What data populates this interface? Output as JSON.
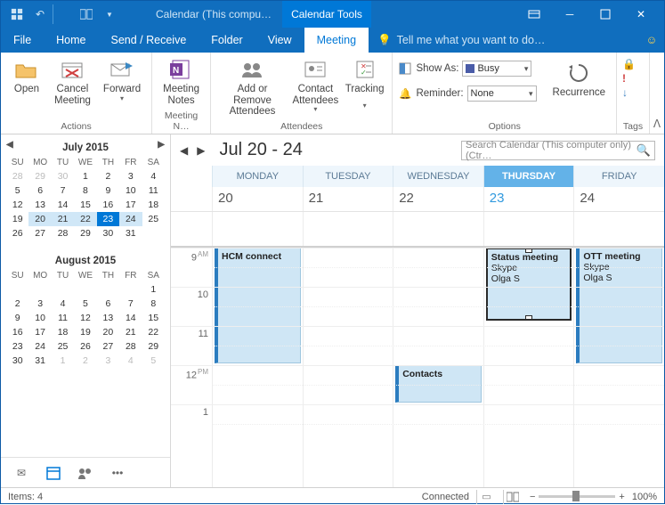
{
  "titlebar": {
    "title": "Calendar (This compu…",
    "tool_tab": "Calendar Tools"
  },
  "menubar": {
    "file": "File",
    "home": "Home",
    "sendreceive": "Send / Receive",
    "folder": "Folder",
    "view": "View",
    "meeting": "Meeting",
    "tell_placeholder": "Tell me what you want to do…"
  },
  "ribbon": {
    "actions": {
      "label": "Actions",
      "open": "Open",
      "cancel": "Cancel\nMeeting",
      "forward": "Forward"
    },
    "notes": {
      "label": "Meeting N…",
      "notes": "Meeting\nNotes"
    },
    "attendees": {
      "label": "Attendees",
      "addremove": "Add or Remove\nAttendees",
      "contact": "Contact\nAttendees",
      "tracking": "Tracking"
    },
    "options": {
      "label": "Options",
      "showas": "Show As:",
      "showas_val": "Busy",
      "reminder": "Reminder:",
      "reminder_val": "None",
      "recurrence": "Recurrence"
    },
    "tags": {
      "label": "Tags"
    }
  },
  "minical": {
    "month1": "July 2015",
    "month2": "August 2015",
    "dow": [
      "SU",
      "MO",
      "TU",
      "WE",
      "TH",
      "FR",
      "SA"
    ],
    "jul": [
      {
        "c": [
          {
            "v": "28",
            "d": 1
          },
          {
            "v": "29",
            "d": 1
          },
          {
            "v": "30",
            "d": 1
          },
          {
            "v": "1"
          },
          {
            "v": "2"
          },
          {
            "v": "3"
          },
          {
            "v": "4"
          }
        ]
      },
      {
        "c": [
          {
            "v": "5"
          },
          {
            "v": "6"
          },
          {
            "v": "7"
          },
          {
            "v": "8"
          },
          {
            "v": "9"
          },
          {
            "v": "10"
          },
          {
            "v": "11"
          }
        ]
      },
      {
        "c": [
          {
            "v": "12"
          },
          {
            "v": "13"
          },
          {
            "v": "14"
          },
          {
            "v": "15"
          },
          {
            "v": "16"
          },
          {
            "v": "17"
          },
          {
            "v": "18"
          }
        ]
      },
      {
        "c": [
          {
            "v": "19"
          },
          {
            "v": "20",
            "s": 1
          },
          {
            "v": "21",
            "s": 1
          },
          {
            "v": "22",
            "s": 1
          },
          {
            "v": "23",
            "t": 1
          },
          {
            "v": "24",
            "s": 1
          },
          {
            "v": "25"
          }
        ]
      },
      {
        "c": [
          {
            "v": "26"
          },
          {
            "v": "27"
          },
          {
            "v": "28"
          },
          {
            "v": "29"
          },
          {
            "v": "30"
          },
          {
            "v": "31"
          },
          {
            "v": ""
          }
        ]
      }
    ],
    "aug": [
      {
        "c": [
          {
            "v": ""
          },
          {
            "v": ""
          },
          {
            "v": ""
          },
          {
            "v": ""
          },
          {
            "v": ""
          },
          {
            "v": ""
          },
          {
            "v": "1"
          }
        ]
      },
      {
        "c": [
          {
            "v": "2"
          },
          {
            "v": "3"
          },
          {
            "v": "4"
          },
          {
            "v": "5"
          },
          {
            "v": "6"
          },
          {
            "v": "7"
          },
          {
            "v": "8"
          }
        ]
      },
      {
        "c": [
          {
            "v": "9"
          },
          {
            "v": "10"
          },
          {
            "v": "11"
          },
          {
            "v": "12"
          },
          {
            "v": "13"
          },
          {
            "v": "14"
          },
          {
            "v": "15"
          }
        ]
      },
      {
        "c": [
          {
            "v": "16"
          },
          {
            "v": "17"
          },
          {
            "v": "18"
          },
          {
            "v": "19"
          },
          {
            "v": "20"
          },
          {
            "v": "21"
          },
          {
            "v": "22"
          }
        ]
      },
      {
        "c": [
          {
            "v": "23"
          },
          {
            "v": "24"
          },
          {
            "v": "25"
          },
          {
            "v": "26"
          },
          {
            "v": "27"
          },
          {
            "v": "28"
          },
          {
            "v": "29"
          }
        ]
      },
      {
        "c": [
          {
            "v": "30"
          },
          {
            "v": "31"
          },
          {
            "v": "1",
            "d": 1
          },
          {
            "v": "2",
            "d": 1
          },
          {
            "v": "3",
            "d": 1
          },
          {
            "v": "4",
            "d": 1
          },
          {
            "v": "5",
            "d": 1
          }
        ]
      }
    ]
  },
  "cal": {
    "range": "Jul 20 - 24",
    "search_placeholder": "Search Calendar (This computer only) (Ctr…",
    "days": [
      "MONDAY",
      "TUESDAY",
      "WEDNESDAY",
      "THURSDAY",
      "FRIDAY"
    ],
    "dates": [
      "20",
      "21",
      "22",
      "23",
      "24"
    ],
    "today_index": 3,
    "hours": [
      {
        "h": "9",
        "ap": "AM"
      },
      {
        "h": "10",
        "ap": ""
      },
      {
        "h": "11",
        "ap": ""
      },
      {
        "h": "12",
        "ap": "PM"
      },
      {
        "h": "1",
        "ap": ""
      }
    ],
    "events": {
      "hcm": {
        "title": "HCM connect"
      },
      "status": {
        "title": "Status meeting",
        "loc": "Skype",
        "who": "Olga S"
      },
      "ott": {
        "title": "OTT meeting",
        "loc": "Skype",
        "who": "Olga S"
      },
      "contacts": {
        "title": "Contacts"
      }
    }
  },
  "status": {
    "items": "Items: 4",
    "connected": "Connected",
    "zoom": "100%"
  }
}
